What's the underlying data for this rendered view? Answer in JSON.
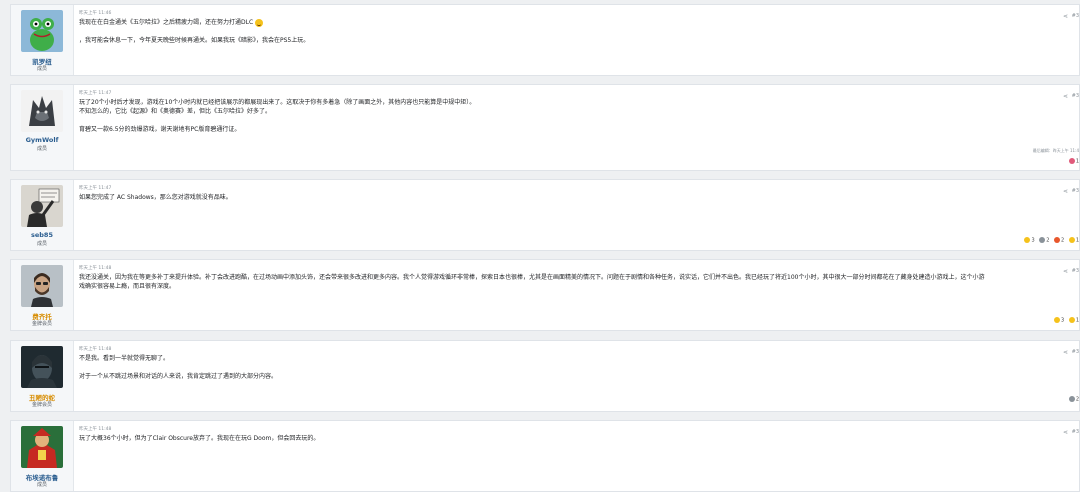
{
  "posts": [
    {
      "username": "凯罗纽",
      "user_title": "成员",
      "time": "昨天上午 11:46",
      "num": "#3",
      "lines": [
        "我现在在白金通关《五尔哈拉》之后精疲力竭，还在努力打通DLC",
        "",
        "，我可能会休息一下，今年夏天晚些时候再通关。如果我玩《暗影》，我会在PS5上玩。"
      ]
    },
    {
      "username": "GymWolf",
      "user_title": "成员",
      "time": "昨天上午 11:47",
      "num": "#3",
      "lines": [
        "玩了20个小时后才发现，游戏在10个小时内就已经把该展示的都展现出来了。这取决于你有多着急（除了画面之外，其他内容也只能算是中规中矩）。",
        "不知怎么的，它比《起源》和《奥德赛》差，但比《五尔哈拉》好多了。",
        "",
        "育碧又一款6.5分的劲爆游戏，谢天谢地有PC版育碧通行证。"
      ],
      "edited": "最后编辑：昨天上午 11:4",
      "reactions": [
        {
          "color": "#e05a7a",
          "count": "1"
        }
      ]
    },
    {
      "username": "seb85",
      "user_title": "成员",
      "time": "昨天上午 11:47",
      "num": "#3",
      "lines": [
        "如果您完成了 AC Shadows，那么您对游戏就没有品味。"
      ],
      "reactions": [
        {
          "color": "#f5c21b",
          "count": "3"
        },
        {
          "color": "#8a9299",
          "count": "2"
        },
        {
          "color": "#e8572c",
          "count": "2"
        },
        {
          "color": "#f5c21b",
          "count": "1"
        }
      ]
    },
    {
      "username": "费齐托",
      "user_title": "金牌会员",
      "time": "昨天上午 11:48",
      "num": "#3",
      "lines": [
        "我还没通关，因为我在等更多补丁来提升体验。补丁会改进跑酷，在过场动画中添加头饰，还会带来很多改进和更多内容。我个人觉得游戏循环非常棒，探索日本也很棒，尤其是在画面精美的情况下。问题在于剧情和各种任务，说实话，它们并不出色。我已经玩了将近100个小时，其中很大一部分时间都花在了藏身处建造小游戏上，这个小游",
        "戏确实很容易上瘾，而且很有深度。"
      ],
      "reactions": [
        {
          "color": "#f5c21b",
          "count": "3"
        },
        {
          "color": "#f5c21b",
          "count": "1"
        }
      ]
    },
    {
      "username": "丑陋的蛇",
      "user_title": "金牌会员",
      "time": "昨天上午 11:48",
      "num": "#3",
      "lines": [
        "不是我。看到一半就觉得无聊了。",
        "",
        "对于一个从不跳过场景和对话的人来说，我肯定跳过了遇到的大部分内容。"
      ],
      "reactions": [
        {
          "color": "#8a9299",
          "count": "2"
        }
      ]
    },
    {
      "username": "布埃诺布鲁",
      "user_title": "成员",
      "time": "昨天上午 11:48",
      "num": "#3",
      "lines": [
        "玩了大概36个小时，但为了Clair Obscure放弃了。我现在在玩G Doom，但会回去玩的。"
      ]
    }
  ],
  "share_icon": "share-icon"
}
